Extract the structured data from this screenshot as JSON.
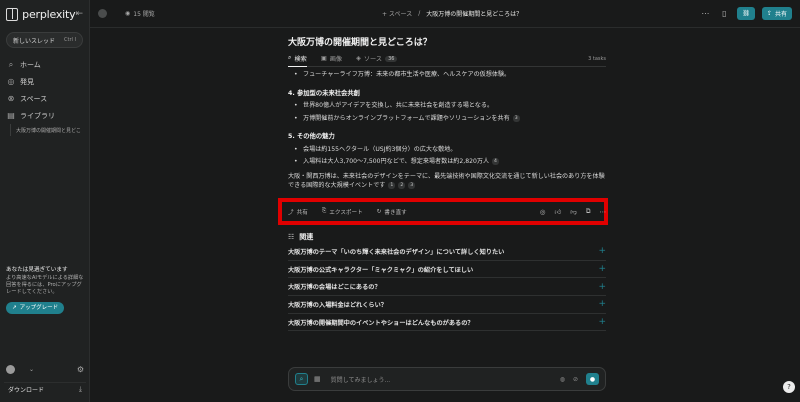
{
  "app": {
    "name": "perplexity"
  },
  "sidebar": {
    "new_thread": {
      "label": "新しいスレッド",
      "shortcut": "Ctrl I"
    },
    "items": [
      {
        "label": "ホーム",
        "icon": "search-icon"
      },
      {
        "label": "発見",
        "icon": "globe-icon"
      },
      {
        "label": "スペース",
        "icon": "spaces-icon"
      },
      {
        "label": "ライブラリ",
        "icon": "library-icon"
      }
    ],
    "library_thread": "大阪万博の開催期間と見どこ",
    "upsell": {
      "title": "あなたは見過ぎています",
      "body": "より高速なAIモデルによる詳細な回答を得るには、Proにアップグレードしてください。",
      "button": "アップグレード"
    },
    "download_label": "ダウンロード"
  },
  "topbar": {
    "views": "15 閲覧",
    "crumb_space": "+ スペース",
    "crumb_sep": "/",
    "crumb_title": "大阪万博の開催期間と見どころは？",
    "share_label": "共有"
  },
  "question": {
    "title": "大阪万博の開催期間と見どころは？",
    "tabs": [
      {
        "label": "検索",
        "icon": "search-icon"
      },
      {
        "label": "画像",
        "icon": "image-icon"
      },
      {
        "label": "ソース",
        "icon": "sources-icon",
        "count": "36"
      }
    ],
    "tasks": "3 tasks"
  },
  "answer": {
    "bullet_top": "フューチャーライフ万博：未来の都市生活や医療、ヘルスケアの仮想体験。",
    "section4": {
      "heading": "4. 参加型の未来社会共創",
      "bullets": [
        {
          "text": "世界80億人がアイデアを交換し、共に未来社会を創造する場となる。"
        },
        {
          "text": "万博開催前からオンラインプラットフォームで課題やソリューションを共有",
          "cite": "3"
        }
      ]
    },
    "section5": {
      "heading": "5. その他の魅力",
      "bullets": [
        {
          "text": "会場は約155ヘクタール（USJ約3個分）の広大な敷地。"
        },
        {
          "text": "入場料は大人3,700〜7,500円などで、想定来場者数は約2,820万人",
          "cite": "4"
        }
      ]
    },
    "summary": "大阪・関西万博は、未来社会のデザインをテーマに、最先端技術や国際文化交流を通じて新しい社会のあり方を体験できる国際的な大規模イベントです",
    "summary_cites": [
      "1",
      "2",
      "3"
    ]
  },
  "actions": {
    "share": "共有",
    "export": "エクスポート",
    "rewrite": "書き直す"
  },
  "related": {
    "heading": "関連",
    "items": [
      "大阪万博のテーマ「いのち輝く未来社会のデザイン」について詳しく知りたい",
      "大阪万博の公式キャラクター「ミャクミャク」の紹介をしてほしい",
      "大阪万博の会場はどこにあるの？",
      "大阪万博の入場料金はどれくらい？",
      "大阪万博の開催期間中のイベントやショーはどんなものがあるの？"
    ]
  },
  "askbox": {
    "placeholder": "質問してみましょう..."
  },
  "colors": {
    "accent": "#20808d",
    "highlight": "#e00000",
    "background": "#191a1a"
  }
}
